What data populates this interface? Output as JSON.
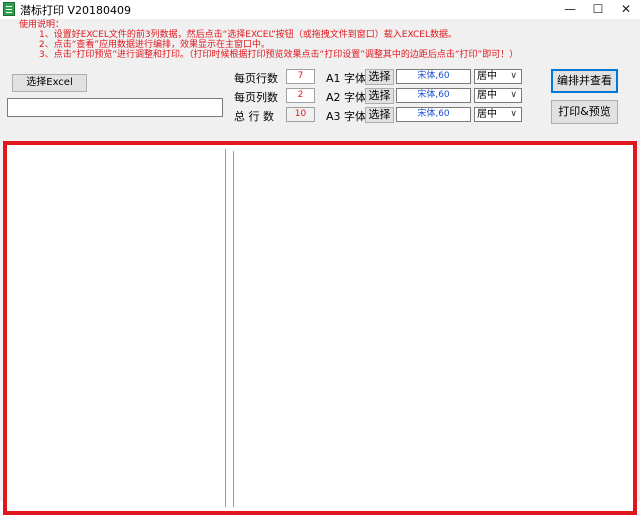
{
  "window": {
    "title": "潜标打印 V20180409",
    "min_glyph": "—",
    "max_glyph": "☐",
    "close_glyph": "✕"
  },
  "instructions": {
    "heading": "使用说明：",
    "line1": "1、设置好EXCEL文件的前3列数据，然后点击“选择EXCEL”按钮（或拖拽文件到窗口）载入EXCEL数据。",
    "line2": "2、点击“查看”应用数据进行编排，效果显示在主窗口中。",
    "line3": "3、点击“打印预览”进行调整和打印。（打印时候根据打印预览效果点击“打印设置”调整其中的边距后点击“打印”即可！）"
  },
  "excel": {
    "select_label": "选择Excel",
    "path_value": ""
  },
  "layout": {
    "rows_label": "每页行数",
    "rows_value": "7",
    "cols_label": "每页列数",
    "cols_value": "2",
    "total_label": "总 行 数",
    "total_value": "10"
  },
  "fonts": [
    {
      "label": "A1 字体",
      "choose": "选择",
      "value": "宋体,60",
      "align": "居中"
    },
    {
      "label": "A2 字体",
      "choose": "选择",
      "value": "宋体,60",
      "align": "居中"
    },
    {
      "label": "A3 字体",
      "choose": "选择",
      "value": "宋体,60",
      "align": "居中"
    }
  ],
  "actions": {
    "arrange_view": "编排并查看",
    "print_preview": "打印&预览"
  },
  "colors": {
    "accent_red": "#e0181d",
    "font_value_blue": "#1a4fd6",
    "default_button_border": "#0078d7"
  }
}
